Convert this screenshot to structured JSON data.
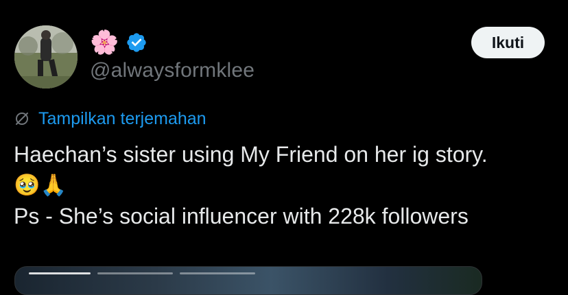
{
  "author": {
    "name_emoji": "🌸",
    "handle": "@alwaysformklee",
    "verified_color": "#1d9bf0"
  },
  "follow_button": {
    "label": "Ikuti"
  },
  "translate": {
    "label": "Tampilkan terjemahan",
    "icon": "translate-icon"
  },
  "tweet": {
    "line1": "Haechan’s sister using My Friend on her ig story.",
    "line2": "🥹🙏",
    "line3": "Ps - She’s social influencer with 228k followers"
  },
  "colors": {
    "background": "#000000",
    "text": "#e7e9ea",
    "secondary": "#71767b",
    "link": "#1d9bf0"
  }
}
